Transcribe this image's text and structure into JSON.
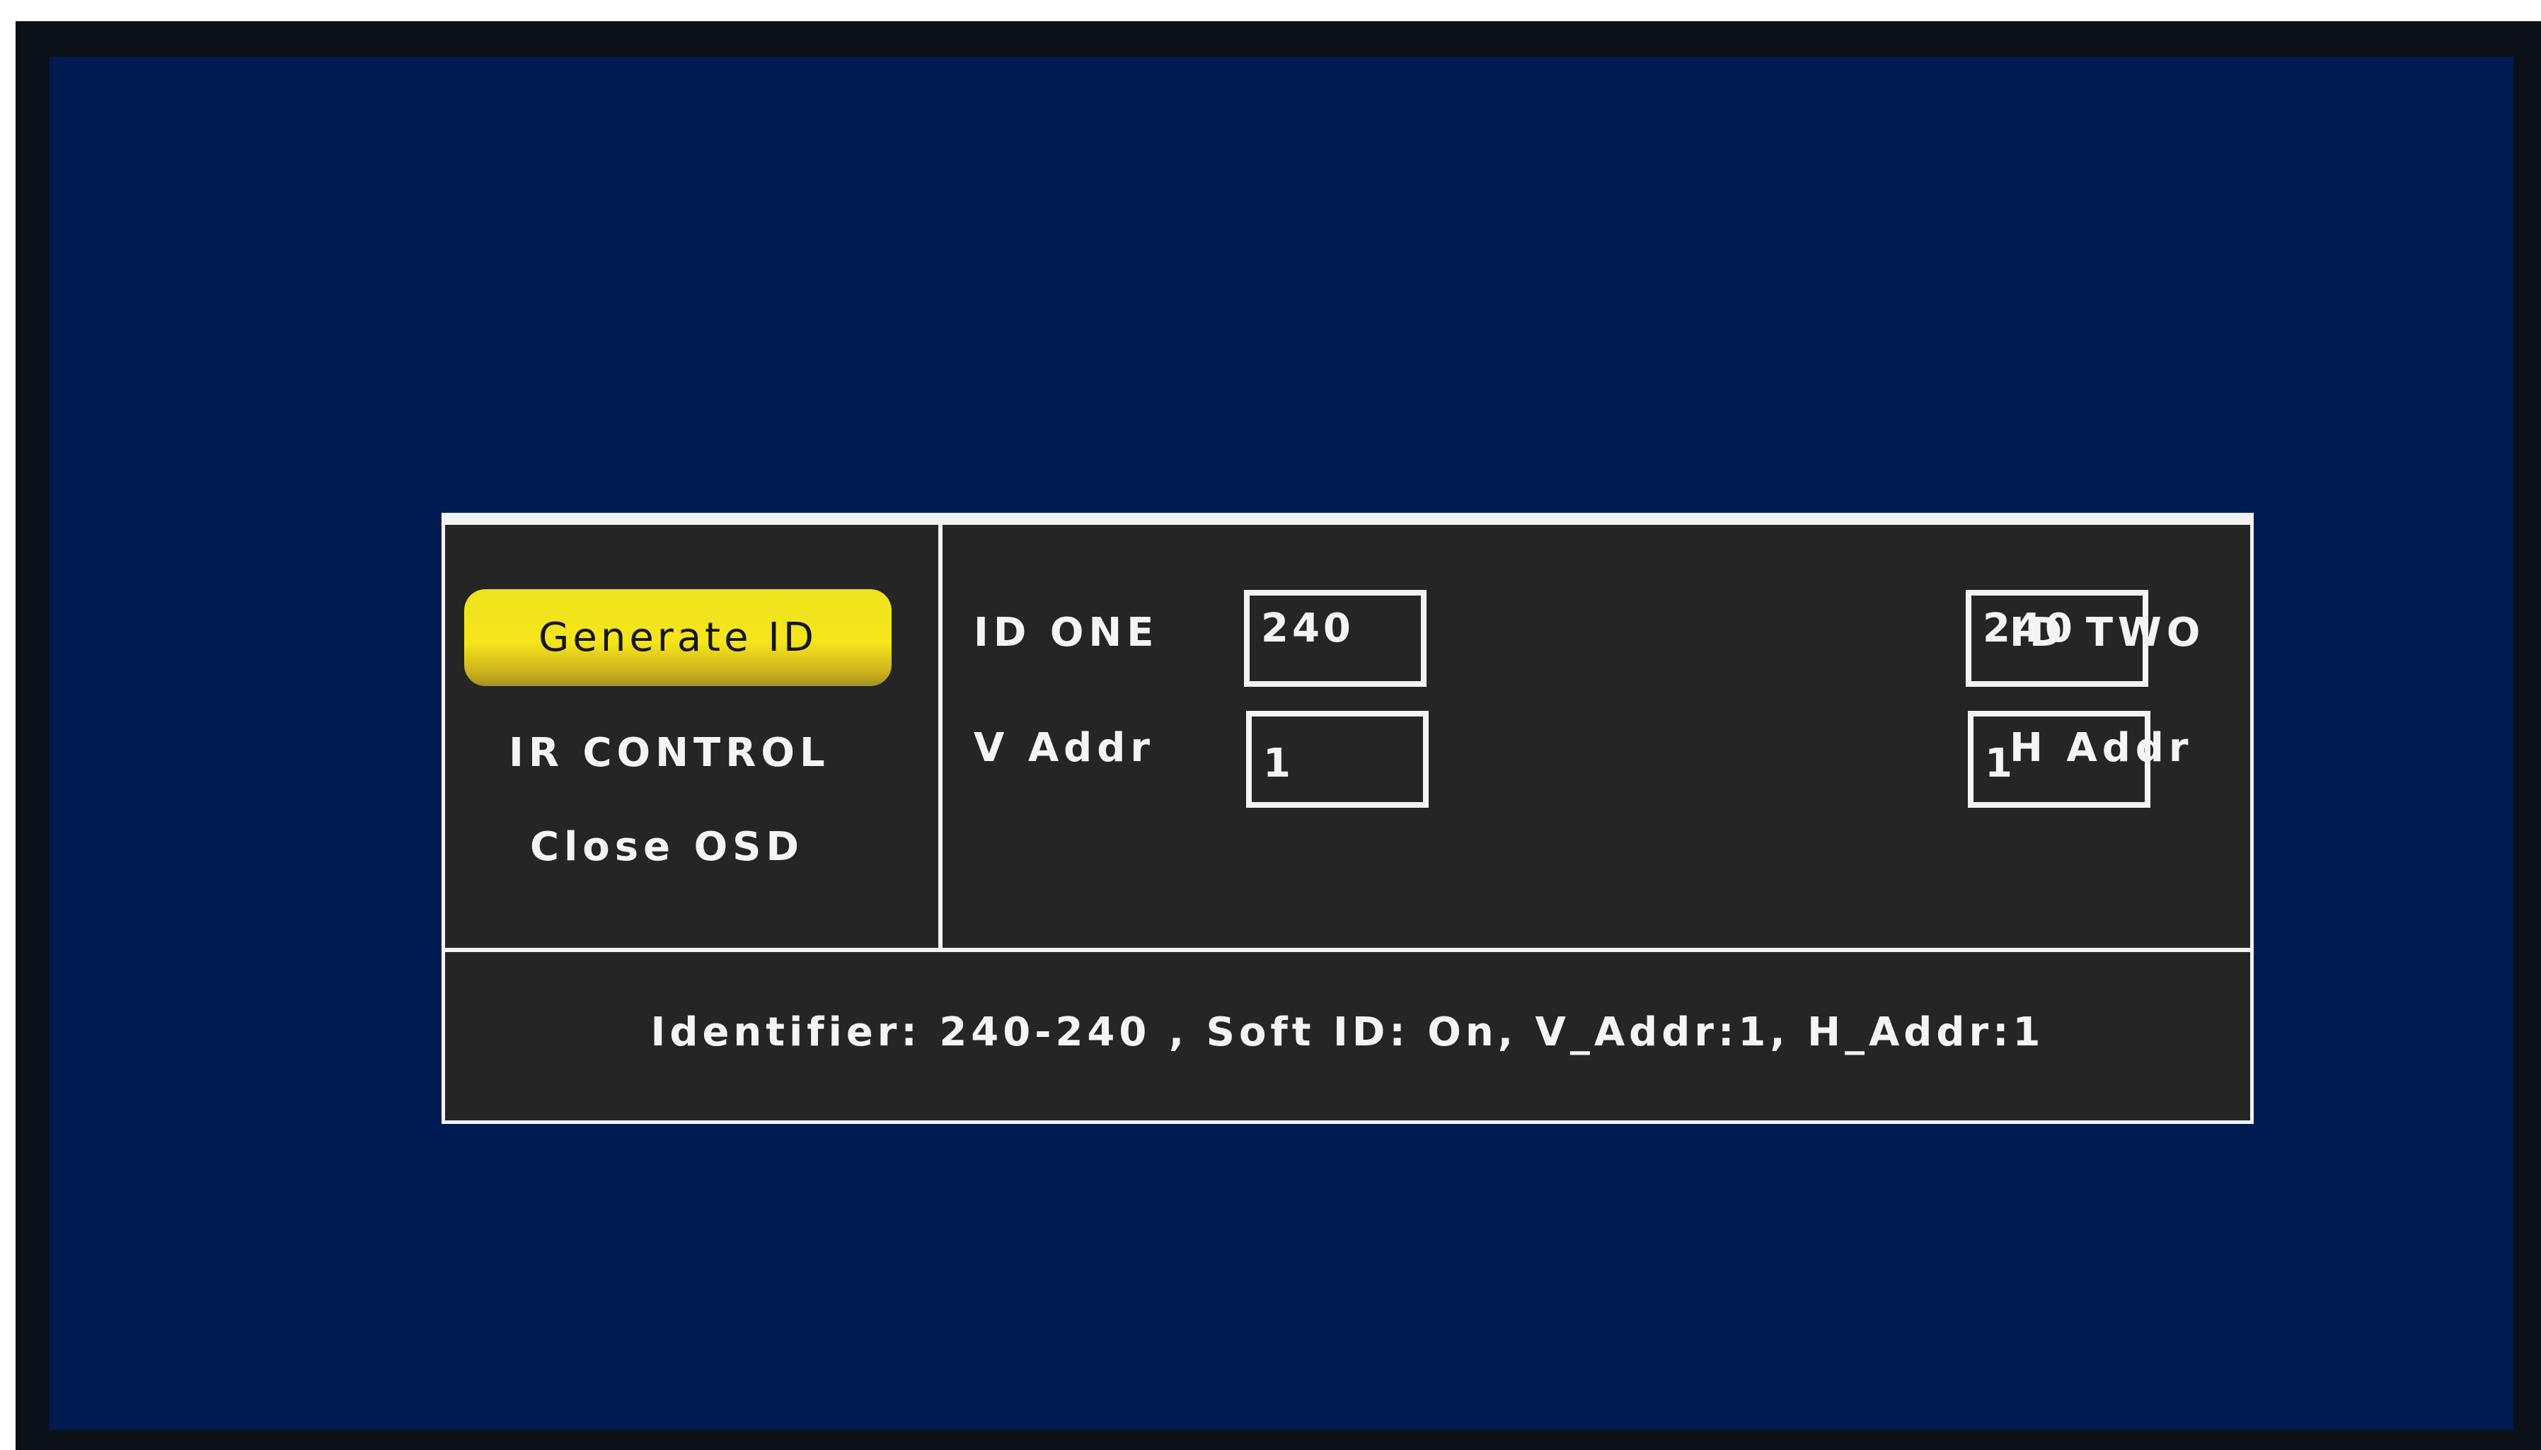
{
  "osd": {
    "menu": {
      "generate_id": "Generate ID",
      "ir_control": "IR CONTROL",
      "close_osd": "Close OSD"
    },
    "fields": {
      "id_one": {
        "label": "ID ONE",
        "value": "240"
      },
      "id_two": {
        "label": "ID TWO",
        "value": "240"
      },
      "v_addr": {
        "label": "V Addr",
        "value": "1"
      },
      "h_addr": {
        "label": "H Addr",
        "value": "1"
      }
    },
    "status": "Identifier: 240-240 , Soft ID: On, V_Addr:1, H_Addr:1"
  },
  "colors": {
    "screen_background": "#001b52",
    "monitor_bezel": "#0b1117",
    "panel_background": "#252525",
    "panel_border": "#f2f2f2",
    "highlight": "#f5e51b",
    "text": "#f4f4f4"
  }
}
